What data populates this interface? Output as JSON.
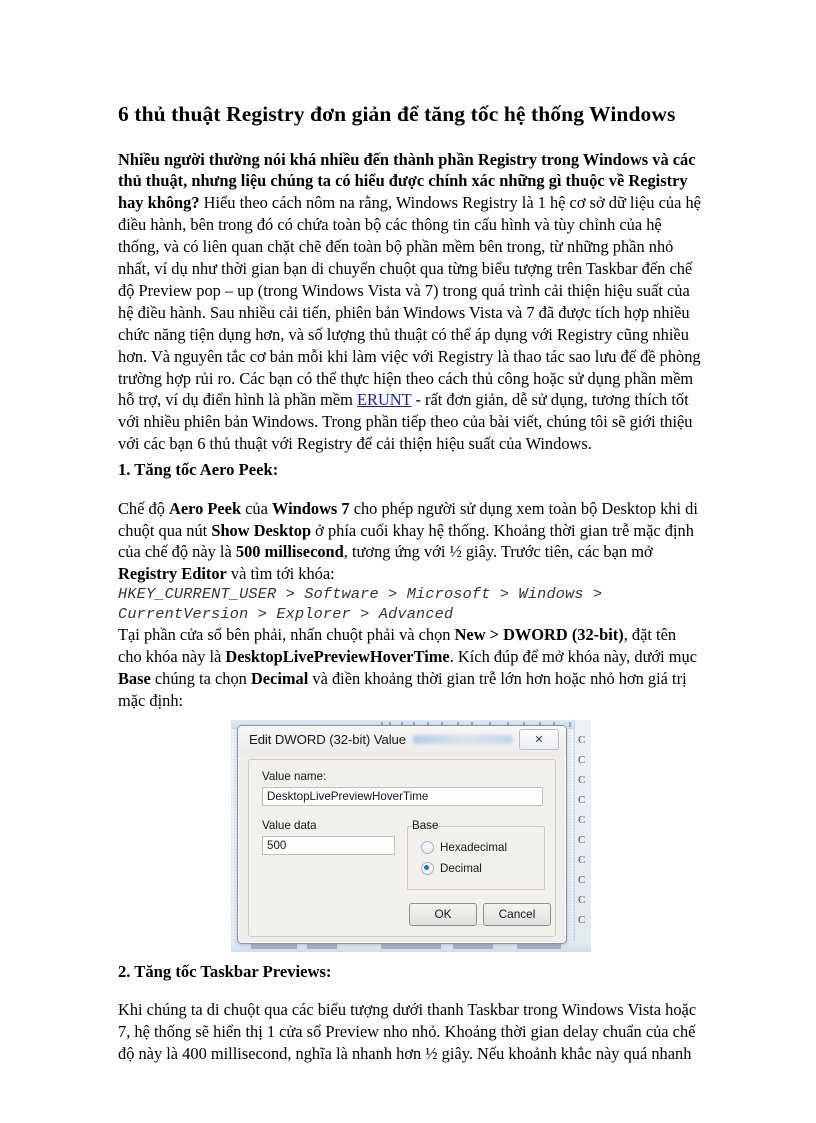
{
  "document": {
    "title": "6 thủ thuật Registry đơn giản để tăng tốc hệ thống Windows",
    "intro_bold": "Nhiều người thường nói khá nhiều đến thành phần Registry trong Windows và các thủ thuật, nhưng liệu chúng ta có hiểu được chính xác những gì thuộc về Registry hay không?",
    "intro_rest_1": " Hiểu theo cách nôm na rằng, Windows Registry là 1 hệ cơ sở dữ liệu của hệ điều hành, bên trong đó có chứa toàn bộ các thông tin cấu hình và tùy chỉnh của hệ thống, và có liên quan chặt chẽ đến toàn bộ phần mềm bên trong, từ những phần nhỏ nhất, ví dụ như thời gian bạn di chuyển chuột qua từng biểu tượng trên Taskbar đến chế độ Preview pop – up (trong Windows Vista và 7) trong quá trình cải thiện hiệu suất của hệ điều hành. Sau nhiều cải tiến, phiên bản Windows Vista và 7 đã được tích hợp nhiều chức năng tiện dụng hơn, và số lượng thủ thuật có thể áp dụng với Registry cũng nhiều hơn. Và nguyên tắc cơ bản mỗi khi làm việc với Registry là thao tác sao lưu để đề phòng trường hợp rủi ro. Các bạn có thể thực hiện theo cách thủ công hoặc sử dụng phần mềm hỗ trợ, ví dụ điển hình là phần mềm ",
    "intro_link": "ERUNT",
    "intro_rest_2": " - rất đơn giản, dễ sử dụng, tương thích tốt với nhiều phiên bản Windows. Trong phần tiếp theo của bài viết, chúng tôi sẽ giới thiệu với các bạn 6 thủ thuật với Registry để cải thiện hiệu suất của Windows."
  },
  "section1": {
    "heading": "1. Tăng tốc Aero Peek:",
    "p1_a": "Chế độ ",
    "p1_b1": "Aero Peek",
    "p1_c": " của ",
    "p1_b2": "Windows 7",
    "p1_d": " cho phép người sử dụng xem toàn bộ Desktop khi di chuột qua nút ",
    "p1_b3": "Show Desktop",
    "p1_e": " ở phía cuối khay hệ thống. Khoảng thời gian trễ mặc định của chế độ này là ",
    "p1_b4": "500 millisecond",
    "p1_f": ", tương ứng với ½ giây. Trước tiên, các bạn mở ",
    "p1_b5": "Registry Editor",
    "p1_g": " và tìm tới khóa:",
    "regpath_line1": "HKEY_CURRENT_USER > Software > Microsoft > Windows >",
    "regpath_line2": "CurrentVersion > Explorer > Advanced",
    "p2_a": "Tại phần cửa sổ bên phải, nhấn chuột phải và chọn ",
    "p2_b1": "New > DWORD (32-bit)",
    "p2_c": ", đặt tên cho khóa này là ",
    "p2_b2": "DesktopLivePreviewHoverTime",
    "p2_d": ". Kích đúp để mở khóa này, dưới mục ",
    "p2_b3": "Base",
    "p2_e": " chúng ta chọn ",
    "p2_b4": "Decimal",
    "p2_f": " và điền khoảng thời gian trễ lớn hơn hoặc nhỏ hơn giá trị mặc định:"
  },
  "dialog": {
    "title": "Edit DWORD (32-bit) Value",
    "close_glyph": "✕",
    "value_name_label": "Value name:",
    "value_name": "DesktopLivePreviewHoverTime",
    "value_data_label": "Value data",
    "value_data": "500",
    "base_label": "Base",
    "radio_hexadecimal": "Hexadecimal",
    "radio_decimal": "Decimal",
    "selected_base": "Decimal",
    "ok_label": "OK",
    "cancel_label": "Cancel",
    "accent_color": "#1a7fa8"
  },
  "section2": {
    "heading": "2. Tăng tốc Taskbar Previews:",
    "p1": "Khi chúng ta di chuột qua các biểu tượng dưới thanh Taskbar trong Windows Vista hoặc 7, hệ thống sẽ hiển thị 1 cửa sổ Preview nho nhỏ. Khoảng thời gian delay chuẩn của chế độ này là 400 millisecond, nghĩa là nhanh hơn ½ giây. Nếu khoảnh khắc này quá nhanh"
  }
}
